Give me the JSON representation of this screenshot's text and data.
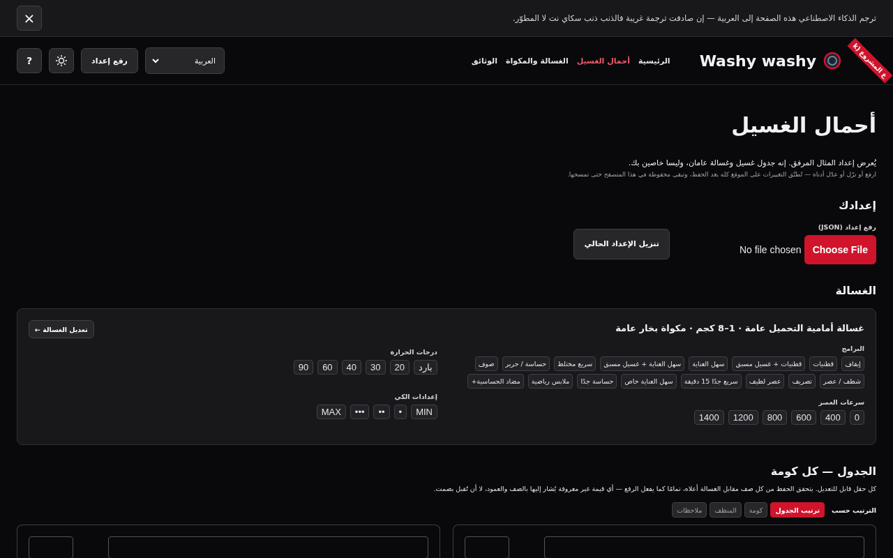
{
  "banner": {
    "text": "ترجم الذكاء الاصطناعي هذه الصفحة إلى العربية — إن صادفت ترجمة غريبة فالذنب ذنب سكاي نت لا المطوّر.",
    "close": "×"
  },
  "header": {
    "logo": "Washy washy",
    "ribbon": "ع المشروع (k",
    "nav": [
      {
        "label": "الرئيسية",
        "selected": false
      },
      {
        "label": "أحمال الغسيل",
        "selected": true
      },
      {
        "label": "الغسالة والمكواة",
        "selected": false
      },
      {
        "label": "الوثائق",
        "selected": false
      }
    ],
    "language": "العربية",
    "upload_button": "رفع إعداد",
    "help_button": "?"
  },
  "page": {
    "title": "أحمال الغسيل",
    "intro": "يُعرض إعداد المثال المرفق. إنه جدول غسيل وغسالة عامان، وليسا خاصين بك.",
    "hint": "ارفع أو نزّل أو عدّل أدناه — تُطبَّق التغييرات على الموقع كله بعد الحفظ، وتبقى محفوظة في هذا المتصفح حتى تمسحها."
  },
  "setup": {
    "heading": "إعدادك",
    "upload_label": "رفع إعداد (JSON)",
    "choose_file": "Choose File",
    "no_file": "No file chosen",
    "download_button": "تنزيل الإعداد الحالي"
  },
  "washer": {
    "heading": "الغسالة",
    "title": "غسالة أمامية التحميل عامة · 1–8 كجم · مكواة بخار عامة",
    "edit_button": "تعديل الغسالة ←",
    "programs_label": "البرامج",
    "programs": [
      "إيقاف",
      "قطنيات",
      "قطنيات + غسيل مسبق",
      "سهل العناية",
      "سهل العناية + غسيل مسبق",
      "سريع مختلط",
      "حساسة / حرير",
      "صوف",
      "شطف / عصر",
      "تصريف",
      "عصر لطيف",
      "سريع جدًا 15 دقيقة",
      "سهل العناية خاص",
      "حساسة جدًا",
      "ملابس رياضية",
      "مضاد الحساسية+"
    ],
    "spin_label": "سرعات العصر",
    "spins": [
      "0",
      "400",
      "600",
      "800",
      "1200",
      "1400"
    ],
    "temp_label": "درجات الحرارة",
    "temps": [
      "بارد",
      "20",
      "30",
      "40",
      "60",
      "90"
    ],
    "iron_label": "إعدادات الكي",
    "irons": [
      "MIN",
      "•",
      "••",
      "•••",
      "MAX"
    ]
  },
  "schedule": {
    "heading": "الجدول — كل كومة",
    "description": "كل حقل قابل للتعديل. يتحقق الحفظ من كل صف مقابل الغسالة أعلاه، تمامًا كما يفعل الرفع — أي قيمة غير معروفة يُشار إليها بالصف والعمود، لا أن تُقبل بصمت.",
    "sort_label": "الترتيب حسب",
    "sort_options": [
      {
        "label": "ترتيب الجدول",
        "selected": true
      },
      {
        "label": "كومة",
        "selected": false
      },
      {
        "label": "المنظف",
        "selected": false
      },
      {
        "label": "ملاحظات",
        "selected": false
      }
    ],
    "cards": [
      {
        "kind": "load"
      },
      {
        "kind": "load"
      }
    ]
  }
}
